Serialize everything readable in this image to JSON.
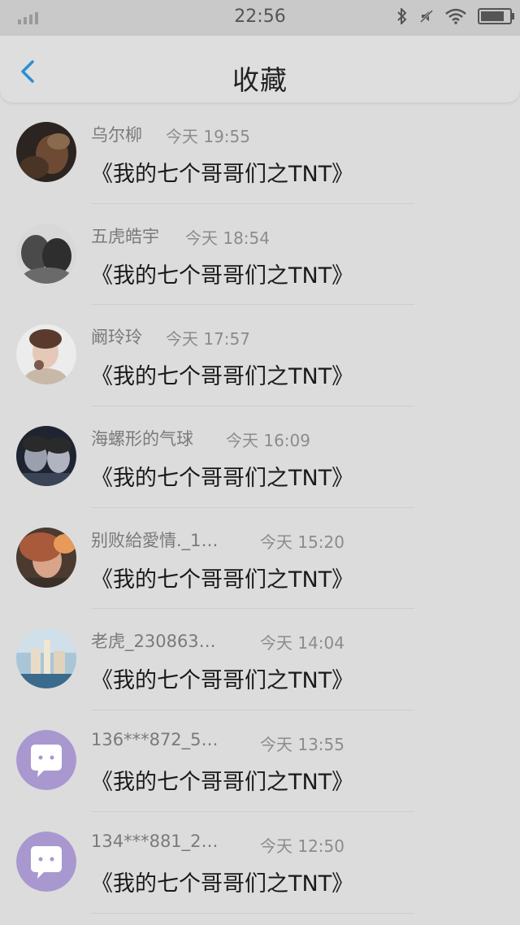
{
  "status_bar": {
    "time": "22:56",
    "icons": [
      "signal-icon",
      "bluetooth-icon",
      "mute-icon",
      "wifi-icon",
      "battery-icon"
    ]
  },
  "header": {
    "back_icon": "chevron-left-icon",
    "title": "收藏"
  },
  "colors": {
    "accent": "#2a8fd4",
    "background": "#dcdcdc",
    "default_avatar": "#a898cf"
  },
  "items": [
    {
      "name": "乌尔柳",
      "time": "今天 19:55",
      "title": "《我的七个哥哥们之TNT》",
      "avatar": "photo"
    },
    {
      "name": "五虎皓宇",
      "time": "今天 18:54",
      "title": "《我的七个哥哥们之TNT》",
      "avatar": "photo"
    },
    {
      "name": "阚玲玲",
      "time": "今天 17:57",
      "title": "《我的七个哥哥们之TNT》",
      "avatar": "photo"
    },
    {
      "name": "海螺形的气球",
      "time": "今天 16:09",
      "title": "《我的七个哥哥们之TNT》",
      "avatar": "photo"
    },
    {
      "name": "别败給愛情._1…",
      "time": "今天 15:20",
      "title": "《我的七个哥哥们之TNT》",
      "avatar": "photo"
    },
    {
      "name": "老虎_230863…",
      "time": "今天 14:04",
      "title": "《我的七个哥哥们之TNT》",
      "avatar": "photo"
    },
    {
      "name": "136***872_5…",
      "time": "今天 13:55",
      "title": "《我的七个哥哥们之TNT》",
      "avatar": "default"
    },
    {
      "name": "134***881_2…",
      "time": "今天 12:50",
      "title": "《我的七个哥哥们之TNT》",
      "avatar": "default"
    }
  ]
}
